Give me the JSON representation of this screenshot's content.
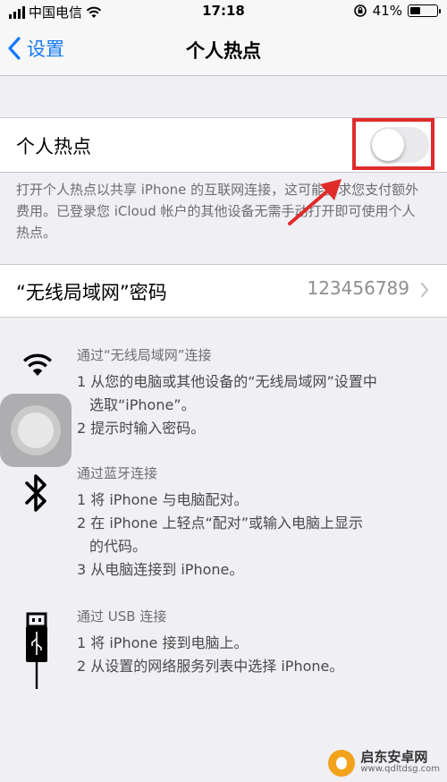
{
  "status_bar": {
    "carrier": "中国电信",
    "time": "17:18",
    "battery": "41%",
    "battery_level": 0.41
  },
  "nav": {
    "back_label": "设置",
    "title": "个人热点"
  },
  "hotspot": {
    "label": "个人热点",
    "enabled": false
  },
  "footnote": "打开个人热点以共享 iPhone 的互联网连接，这可能要求您支付额外费用。已登录您 iCloud 帐户的其他设备无需手动打开即可使用个人热点。",
  "wifi_password": {
    "label": "“无线局域网”密码",
    "value": "123456789"
  },
  "sections": {
    "wifi": {
      "icon": "wifi-icon",
      "heading": "通过“无线局域网”连接",
      "step1_line1": "1 从您的电脑或其他设备的“无线局域网”设置中",
      "step1_line2": "选取“iPhone”。",
      "step2": "2 提示时输入密码。"
    },
    "bluetooth": {
      "icon": "bluetooth-icon",
      "heading": "通过蓝牙连接",
      "step1": "1 将 iPhone 与电脑配对。",
      "step2_line1": "2 在 iPhone 上轻点“配对”或输入电脑上显示",
      "step2_line2": "的代码。",
      "step3": "3 从电脑连接到 iPhone。"
    },
    "usb": {
      "icon": "usb-icon",
      "heading": "通过 USB 连接",
      "step1": "1 将 iPhone 接到电脑上。",
      "step2": "2 从设置的网络服务列表中选择 iPhone。"
    }
  },
  "watermark": {
    "name": "启东安卓网",
    "url": "www.qdltdsg.com"
  },
  "colors": {
    "accent": "#1478f5",
    "highlight": "#e02b2b"
  }
}
